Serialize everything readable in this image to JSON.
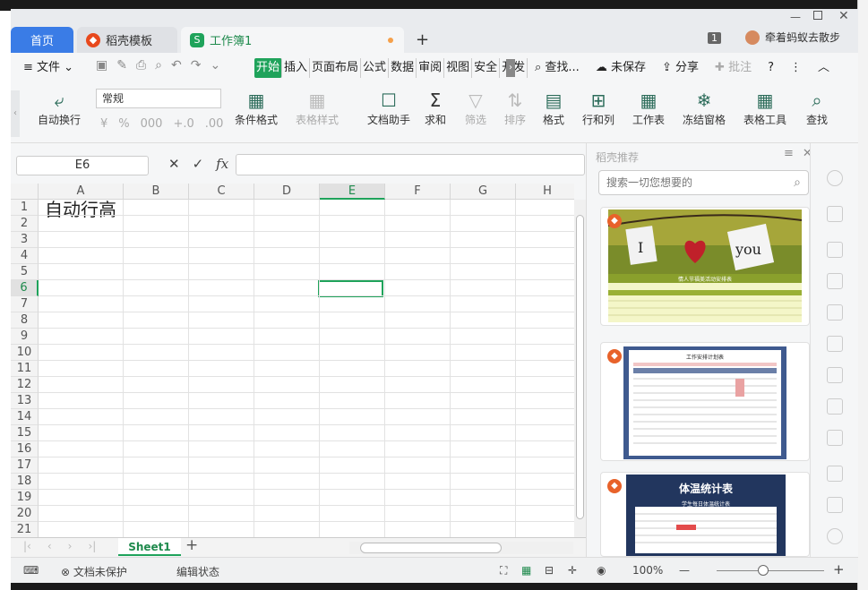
{
  "tabs": {
    "home": "首页",
    "template": "稻壳模板",
    "workbook": "工作簿1",
    "new_tab": "+"
  },
  "window": {
    "badge": "1",
    "user": "牵着蚂蚁去散步"
  },
  "menu": {
    "file": "≡ 文件 ⌄",
    "ribbon_tabs": [
      "开始",
      "插入",
      "页面布局",
      "公式",
      "数据",
      "审阅",
      "视图",
      "安全",
      "开发"
    ],
    "search": "查找...",
    "unsaved": "未保存",
    "share": "分享",
    "comment": "批注"
  },
  "toolbar": {
    "wrap": "自动换行",
    "number_format": "常规",
    "number_buttons": [
      "¥",
      "%",
      "000",
      "+.0",
      ".00"
    ],
    "cond_format": "条件格式",
    "table_style": "表格样式",
    "doc_assistant": "文档助手",
    "sum": "求和",
    "filter": "筛选",
    "sort": "排序",
    "format": "格式",
    "row_col": "行和列",
    "sheet": "工作表",
    "freeze": "冻结窗格",
    "table_tools": "表格工具",
    "find": "查找"
  },
  "formula": {
    "namebox": "E6",
    "fx": "fx",
    "value": ""
  },
  "grid": {
    "columns": [
      "A",
      "B",
      "C",
      "D",
      "E",
      "F",
      "G",
      "H"
    ],
    "rows": [
      "1",
      "2",
      "3",
      "4",
      "5",
      "6",
      "7",
      "8",
      "9",
      "10",
      "11",
      "12",
      "13",
      "14",
      "15",
      "16",
      "17",
      "18",
      "19",
      "20",
      "21"
    ],
    "a1": "自动行高",
    "active_col": "E",
    "active_row": "6"
  },
  "sheets": {
    "active": "Sheet1",
    "add": "+"
  },
  "panel": {
    "title": "稻壳推荐",
    "search_placeholder": "搜索一切您想要的",
    "card1_title": "情人节福美活动安排表",
    "card2_title": "工作安排计划表",
    "card3_title": "体温统计表",
    "card3_subtitle": "学生每日体温统计表"
  },
  "status": {
    "protect": "文档未保护",
    "edit": "编辑状态",
    "zoom": "100%",
    "zoom_out": "—",
    "zoom_in": "+"
  },
  "colors": {
    "accent": "#1fa35b",
    "home_tab": "#3a7ce6"
  }
}
